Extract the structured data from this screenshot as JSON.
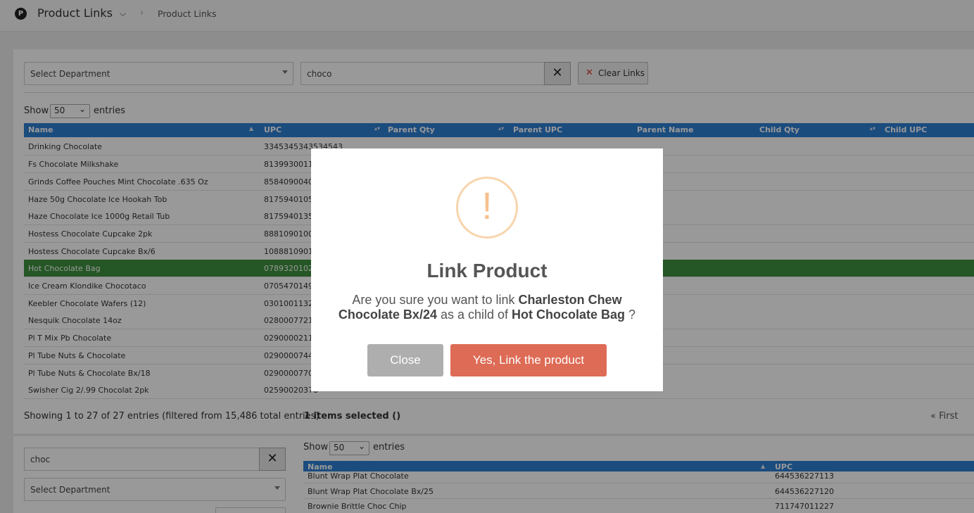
{
  "header": {
    "logo_letter": "P",
    "app_title": "Product Links",
    "breadcrumb": "Product Links"
  },
  "filters": {
    "department_select": "Select Department",
    "search_value": "choco",
    "clear_label": "Clear Links"
  },
  "table": {
    "show_label": "Show",
    "page_size": "50",
    "entries_label": "entries",
    "columns": [
      "Name",
      "UPC",
      "Parent Qty",
      "Parent UPC",
      "Parent Name",
      "Child Qty",
      "Child UPC"
    ],
    "rows": [
      {
        "name": "Drinking Chocolate",
        "upc": "3345345343534543"
      },
      {
        "name": "Fs Chocolate Milkshake",
        "upc": "81399300119"
      },
      {
        "name": "Grinds Coffee Pouches Mint Chocolate .635 Oz",
        "upc": "85840900401"
      },
      {
        "name": "Haze 50g Chocolate Ice Hookah Tob",
        "upc": "81759401054"
      },
      {
        "name": "Haze Chocolate Ice 1000g Retail Tub",
        "upc": "81759401354"
      },
      {
        "name": "Hostess Chocolate Cupcake 2pk",
        "upc": "88810901001"
      },
      {
        "name": "Hostess Chocolate Cupcake Bx/6",
        "upc": "10888109010"
      },
      {
        "name": "Hot Chocolate Bag",
        "upc": "07893201027",
        "selected": true
      },
      {
        "name": "Ice Cream Klondike Chocotaco",
        "upc": "07054701498"
      },
      {
        "name": "Keebler Chocolate Wafers (12)",
        "upc": "03010011321"
      },
      {
        "name": "Nesquik Chocolate 14oz",
        "upc": "02800077212"
      },
      {
        "name": "Pl T Mix Pb Chocolate",
        "upc": "02900002111"
      },
      {
        "name": "Pl Tube Nuts & Chocolate",
        "upc": "02900007446"
      },
      {
        "name": "Pl Tube Nuts & Chocolate Bx/18",
        "upc": "02900007705"
      },
      {
        "name": "Swisher Cig 2/.99 Chocolat 2pk",
        "upc": "02590020378"
      }
    ],
    "info": "Showing 1 to 27 of 27 entries (filtered from 15,486 total entries)",
    "selected_info": "1 items selected ()",
    "first_label": "First"
  },
  "lower": {
    "search_value": "choc",
    "department_select": "Select Department",
    "show_label": "Show",
    "page_size": "50",
    "entries_label": "entries",
    "columns": [
      "Name",
      "UPC"
    ],
    "rows": [
      {
        "name": "Blunt Wrap Plat Chocolate",
        "upc": "644536227113"
      },
      {
        "name": "Blunt Wrap Plat Chocolate Bx/25",
        "upc": "644536227120"
      },
      {
        "name": "Brownie Brittle Choc Chip",
        "upc": "711747011227"
      }
    ]
  },
  "modal": {
    "icon": "warning-icon",
    "icon_glyph": "!",
    "title": "Link Product",
    "text_1": "Are you sure you want to link ",
    "child_product": "Charleston Chew Chocolate Bx/24",
    "text_2": " as a child of ",
    "parent_product": "Hot Chocolate Bag",
    "text_3": " ?",
    "close_label": "Close",
    "confirm_label": "Yes, Link the product",
    "colors": {
      "confirm": "#dd6b55",
      "close": "#aeaeae",
      "warning": "#f8bb86"
    }
  }
}
